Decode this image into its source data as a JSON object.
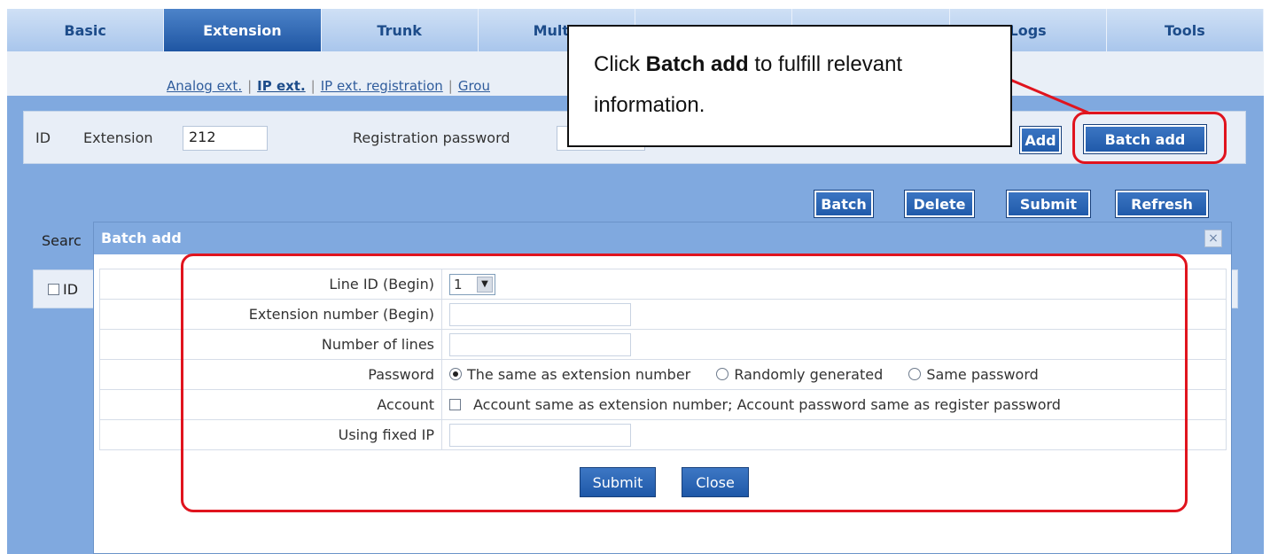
{
  "nav": {
    "tabs": [
      "Basic",
      "Extension",
      "Trunk",
      "Multi-",
      "",
      "",
      "Logs",
      "Tools"
    ],
    "active": 1
  },
  "subnav": {
    "analog": "Analog ext.",
    "ip": "IP ext.",
    "registration": "IP ext. registration",
    "group": "Grou"
  },
  "form": {
    "id_label": "ID",
    "extension_label": "Extension",
    "extension_value": "212",
    "regpass_label": "Registration password",
    "add_button": "Add",
    "batch_add_button": "Batch add"
  },
  "toolbar": {
    "batch": "Batch",
    "delete": "Delete",
    "submit": "Submit",
    "refresh": "Refresh"
  },
  "search_label": "Searc",
  "grid_header": {
    "id": "ID"
  },
  "dialog": {
    "title": "Batch add",
    "close_glyph": "×",
    "rows": {
      "line_id_label": "Line ID (Begin)",
      "line_id_value": "1",
      "ext_number_label": "Extension number (Begin)",
      "num_lines_label": "Number of lines",
      "password_label": "Password",
      "password_opt1": "The same as extension number",
      "password_opt2": "Randomly generated",
      "password_opt3": "Same password",
      "account_label": "Account",
      "account_text": "Account same as extension number; Account password same as register password",
      "fixed_ip_label": "Using fixed IP"
    },
    "submit": "Submit",
    "close": "Close"
  },
  "callout": {
    "prefix": "Click ",
    "bold": "Batch add",
    "suffix": " to fulfill relevant information."
  },
  "colors": {
    "highlight": "#e0141e",
    "nav_active": "#1f56a3",
    "main_bg": "#80a9df"
  }
}
